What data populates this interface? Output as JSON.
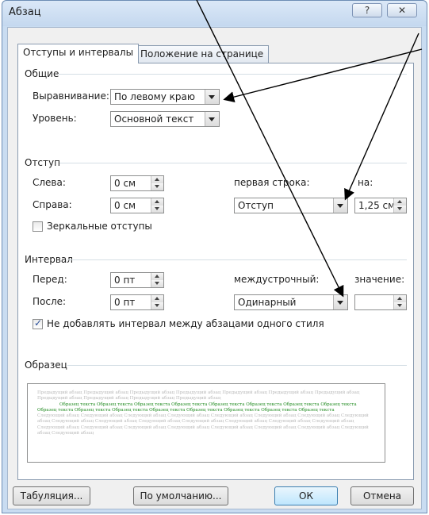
{
  "window": {
    "title": "Абзац",
    "help_glyph": "?",
    "close_glyph": "✕"
  },
  "tabs": [
    {
      "label": "Отступы и интервалы"
    },
    {
      "label": "Положение на странице"
    }
  ],
  "general": {
    "group_title": "Общие",
    "alignment_label": "Выравнивание:",
    "alignment_value": "По левому краю",
    "level_label": "Уровень:",
    "level_value": "Основной текст"
  },
  "indent": {
    "group_title": "Отступ",
    "left_label": "Слева:",
    "left_value": "0 см",
    "right_label": "Справа:",
    "right_value": "0 см",
    "first_line_label": "первая строка:",
    "first_line_value": "Отступ",
    "by_label": "на:",
    "by_value": "1,25 см",
    "mirror_label": "Зеркальные отступы",
    "mirror_checked": false
  },
  "spacing": {
    "group_title": "Интервал",
    "before_label": "Перед:",
    "before_value": "0 пт",
    "after_label": "После:",
    "after_value": "0 пт",
    "line_label": "междустрочный:",
    "line_value": "Одинарный",
    "at_label": "значение:",
    "at_value": "",
    "dont_add_label": "Не добавлять интервал между абзацами одного стиля",
    "dont_add_checked": true
  },
  "preview": {
    "group_title": "Образец",
    "prev_text": "Предыдущий абзац Предыдущий абзац Предыдущий абзац Предыдущий абзац Предыдущий абзац Предыдущий абзац Предыдущий абзац Предыдущий абзац Предыдущий абзац Предыдущий абзац Предыдущий абзац",
    "sample_text": "Образец текста Образец текста Образец текста Образец текста Образец текста Образец текста Образец текста Образец текста Образец текста Образец текста Образец текста Образец текста Образец текста Образец текста Образец текста Образец текста",
    "next_text": "Следующий абзац Следующий абзац Следующий абзац Следующий абзац Следующий абзац Следующий абзац Следующий абзац Следующий абзац Следующий абзац Следующий абзац Следующий абзац Следующий абзац Следующий абзац Следующий абзац Следующий абзац Следующий абзац Следующий абзац Следующий абзац Следующий абзац Следующий абзац Следующий абзац Следующий абзац Следующий абзац Следующий абзац"
  },
  "buttons": {
    "tabs": "Табуляция...",
    "default": "По умолчанию...",
    "ok": "ОК",
    "cancel": "Отмена"
  },
  "colors": {
    "accent": "#3c7fb1",
    "titlebar": "#c4d8ef",
    "preview_sample": "#1f8a1f",
    "annotation_lines": "#000000"
  }
}
